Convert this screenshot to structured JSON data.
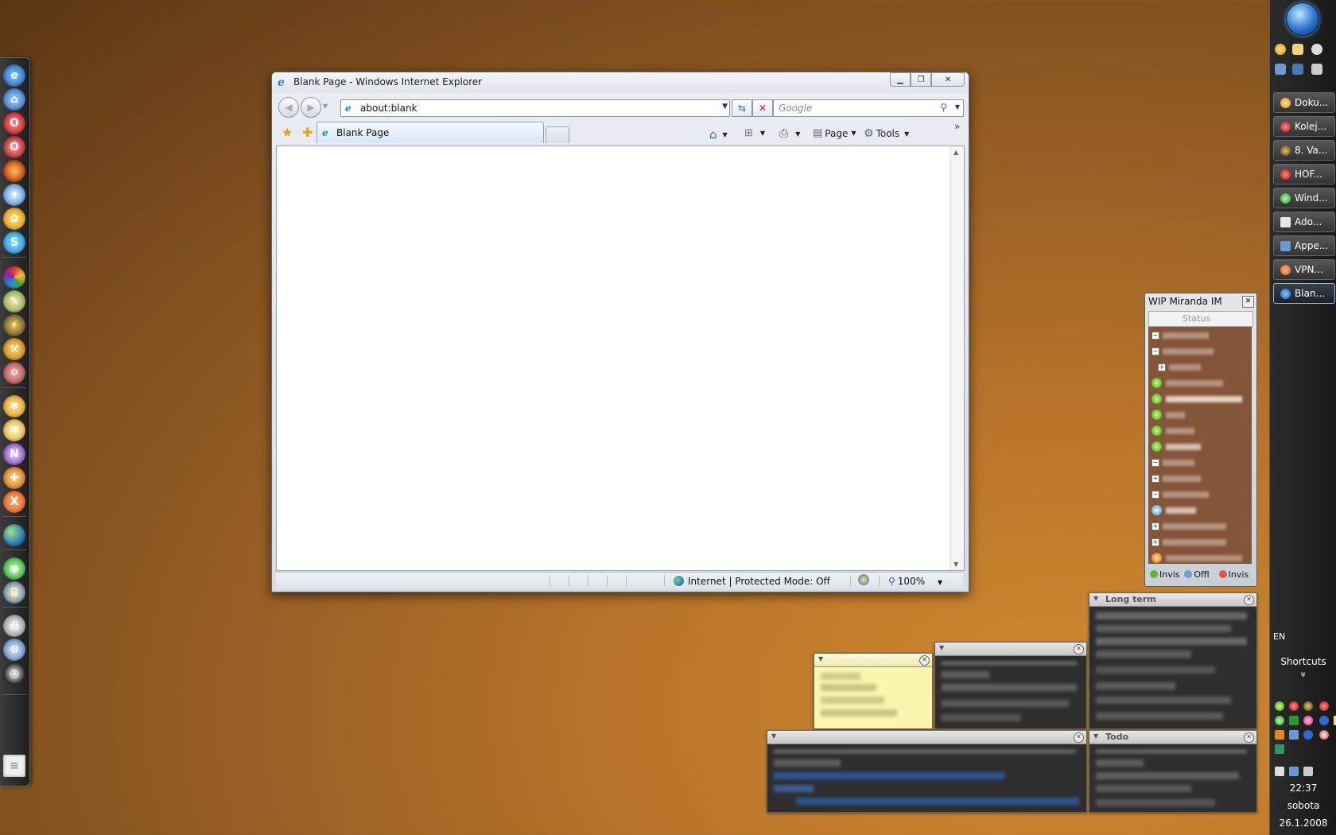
{
  "browser": {
    "window_title": "Blank Page - Windows Internet Explorer",
    "address": "about:blank",
    "search_placeholder": "Google",
    "tab_label": "Blank Page",
    "page_menu": "Page",
    "tools_menu": "Tools",
    "chevron": "»",
    "status_zone": "Internet | Protected Mode: Off",
    "zoom": "100%"
  },
  "taskbar": {
    "buttons": [
      "Doku...",
      "Kolej...",
      "8. Va...",
      "HOF...",
      "Wind...",
      "Ado...",
      "Appe...",
      "VPN...",
      "Blan..."
    ],
    "active_index": 8,
    "language": "EN",
    "shortcuts_label": "Shortcuts",
    "shortcuts_arrow": "»",
    "time": "22:37",
    "day": "sobota",
    "date": "26.1.2008"
  },
  "miranda": {
    "title": "WIP Miranda IM",
    "status_placeholder": "Status",
    "footer": [
      "Invis",
      "Offl",
      "Invis"
    ]
  },
  "notes": {
    "long_term_title": "Long term",
    "todo_title": "Todo"
  },
  "colors": {
    "desktop": "#b8742a",
    "miranda_list_bg": "#835539",
    "note_yellow": "#fbf6b0",
    "active_task_border": "#9cb3d6"
  }
}
